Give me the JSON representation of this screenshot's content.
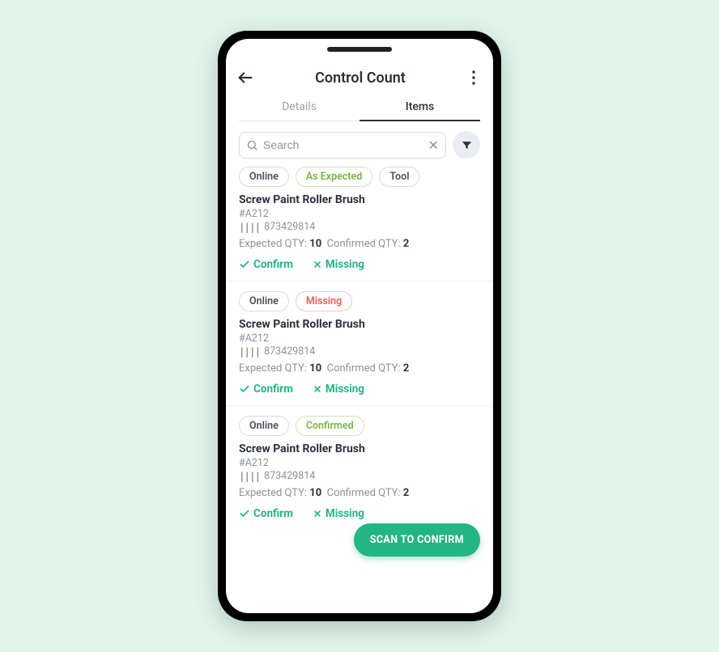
{
  "header": {
    "title": "Control Count"
  },
  "tabs": {
    "details": "Details",
    "items": "Items"
  },
  "search": {
    "placeholder": "Search"
  },
  "labels": {
    "expected": "Expected QTY: ",
    "confirmed": "Confirmed QTY: ",
    "confirm_action": "Confirm",
    "missing_action": "Missing"
  },
  "items": [
    {
      "chips": [
        {
          "text": "Online",
          "variant": "default"
        },
        {
          "text": "As Expected",
          "variant": "green"
        },
        {
          "text": "Tool",
          "variant": "default"
        }
      ],
      "name": "Screw Paint Roller Brush",
      "code": "#A212",
      "barcode": "873429814",
      "expected_qty": "10",
      "confirmed_qty": "2"
    },
    {
      "chips": [
        {
          "text": "Online",
          "variant": "default"
        },
        {
          "text": "Missing",
          "variant": "red"
        }
      ],
      "name": "Screw Paint Roller Brush",
      "code": "#A212",
      "barcode": "873429814",
      "expected_qty": "10",
      "confirmed_qty": "2"
    },
    {
      "chips": [
        {
          "text": "Online",
          "variant": "default"
        },
        {
          "text": "Confirmed",
          "variant": "green"
        }
      ],
      "name": "Screw Paint Roller Brush",
      "code": "#A212",
      "barcode": "873429814",
      "expected_qty": "10",
      "confirmed_qty": "2"
    }
  ],
  "fab": {
    "label": "SCAN TO CONFIRM"
  }
}
